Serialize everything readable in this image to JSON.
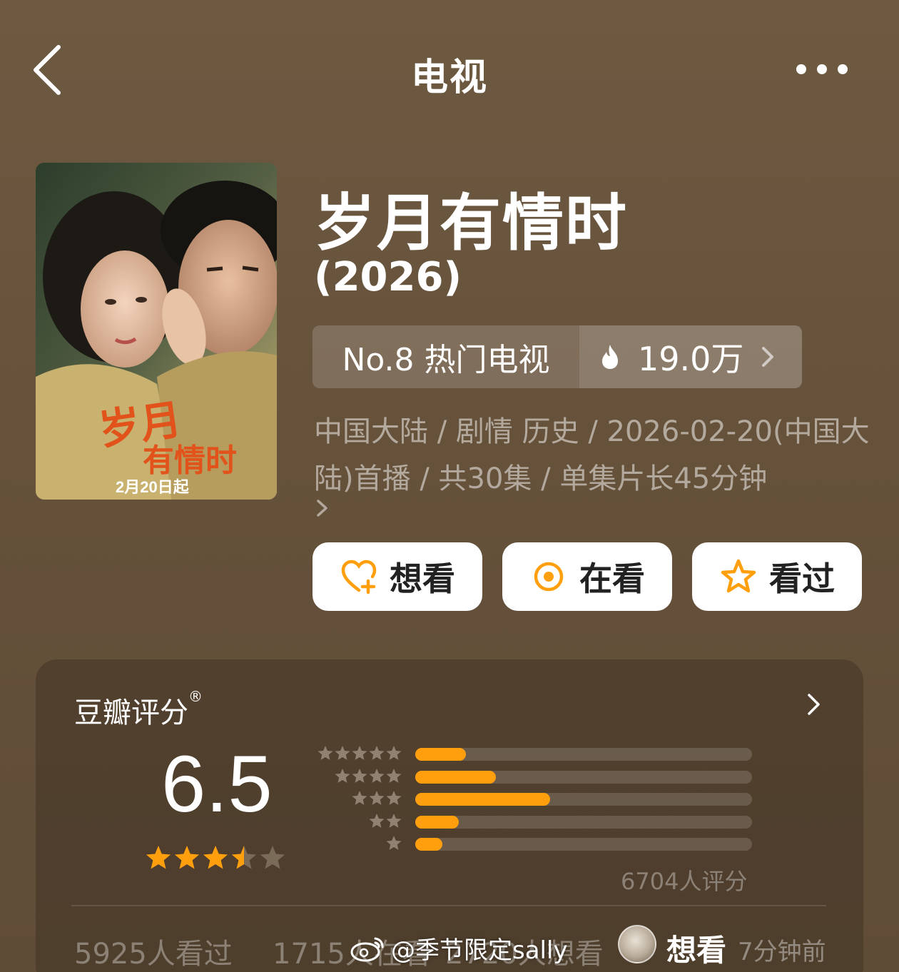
{
  "header": {
    "title": "电视",
    "back_icon": "chevron-left-icon",
    "more_icon": "more-dots-icon"
  },
  "poster": {
    "date_text": "2月20日起",
    "logo_text": "岁月有情时"
  },
  "show": {
    "title": "岁月有情时",
    "year": "(2026)"
  },
  "rank": {
    "label": "No.8 热门电视",
    "heat": "19.0万"
  },
  "meta": {
    "text": "中国大陆 / 剧情 历史 / 2026-02-20(中国大陆)首播 / 共30集 / 单集片长45分钟"
  },
  "actions": [
    {
      "label": "想看",
      "icon": "heart-plus-icon"
    },
    {
      "label": "在看",
      "icon": "target-circle-icon"
    },
    {
      "label": "看过",
      "icon": "star-outline-icon"
    }
  ],
  "rating": {
    "label": "豆瓣评分",
    "registered_mark": "®",
    "score": "6.5",
    "stars_value": 3.5,
    "stars_max": 5,
    "distribution": [
      {
        "stars": 5,
        "fraction": 0.15
      },
      {
        "stars": 4,
        "fraction": 0.24
      },
      {
        "stars": 3,
        "fraction": 0.4
      },
      {
        "stars": 2,
        "fraction": 0.13
      },
      {
        "stars": 1,
        "fraction": 0.08
      }
    ],
    "count_text": "6704人评分",
    "stats": {
      "watched": "5925人看过",
      "watching": "1715人在看",
      "want": "2720人想看"
    }
  },
  "overlay": {
    "watermark": "@季节限定sally",
    "action": "想看",
    "time": "7分钟前"
  },
  "colors": {
    "accent": "#ff9f0e",
    "background": "#6a563e",
    "button_bg": "#ffffff"
  }
}
